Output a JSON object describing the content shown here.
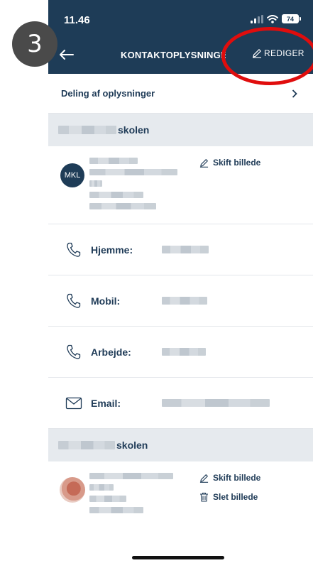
{
  "status": {
    "time": "11.46",
    "battery": "74"
  },
  "nav": {
    "title": "KONTAKTOPLYSNINGE",
    "edit_label": "REDIGER"
  },
  "annotation": {
    "step": "3"
  },
  "share_row": {
    "label": "Deling af oplysninger"
  },
  "sections": [
    {
      "school_suffix": "skolen",
      "avatar_initials": "MKL",
      "change_photo": "Skift billede"
    },
    {
      "school_suffix": "skolen",
      "change_photo": "Skift billede",
      "delete_photo": "Slet billede"
    }
  ],
  "contact_fields": [
    {
      "label": "Hjemme:"
    },
    {
      "label": "Mobil:"
    },
    {
      "label": "Arbejde:"
    },
    {
      "label": "Email:"
    }
  ],
  "colors": {
    "header": "#1e3c57",
    "highlight": "#e00d0d",
    "section_bg": "#e6eaee"
  }
}
